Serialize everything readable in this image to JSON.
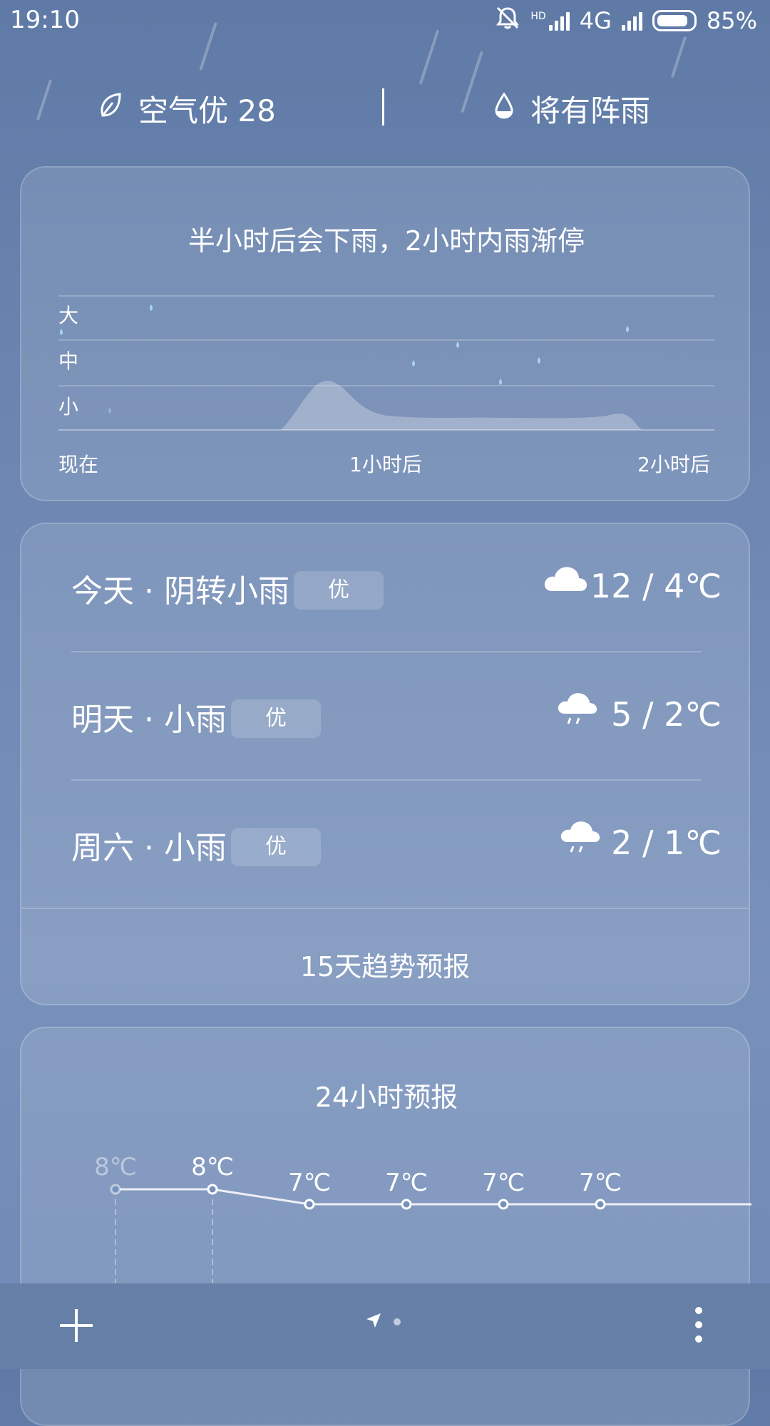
{
  "status_bar": {
    "time": "19:10",
    "network_hd": "HD",
    "network_type": "4G",
    "battery": "85%"
  },
  "top_info": {
    "aqi_text": "空气优 28",
    "rain_hint": "将有阵雨"
  },
  "precip": {
    "title": "半小时后会下雨，2小时内雨渐停",
    "y_labels": [
      "大",
      "中",
      "小"
    ],
    "x_labels": [
      "现在",
      "1小时后",
      "2小时后"
    ]
  },
  "daily": {
    "rows": [
      {
        "label": "今天 · 阴转小雨",
        "aqi": "优",
        "temp": "12 / 4℃",
        "icon": "cloudy-icon"
      },
      {
        "label": "明天 · 小雨",
        "aqi": "优",
        "temp": "5 / 2℃",
        "icon": "light-rain-icon"
      },
      {
        "label": "周六 · 小雨",
        "aqi": "优",
        "temp": "2 / 1℃",
        "icon": "light-rain-icon"
      }
    ],
    "trend_link": "15天趋势预报"
  },
  "hourly": {
    "title": "24小时预报",
    "temps": [
      "8℃",
      "8℃",
      "7℃",
      "7℃",
      "7℃",
      "7℃"
    ]
  },
  "colors": {
    "bg_top": "#5f7aa6",
    "bg_bottom": "#6f8ab6",
    "accent_drop": "#a9d3f2",
    "card_fill": "rgba(255,255,255,0.12)"
  },
  "icons": [
    "leaf-icon",
    "drop-icon",
    "cloudy-icon",
    "light-rain-icon",
    "plus-icon",
    "location-arrow-icon",
    "more-vertical-icon",
    "mute-icon"
  ]
}
